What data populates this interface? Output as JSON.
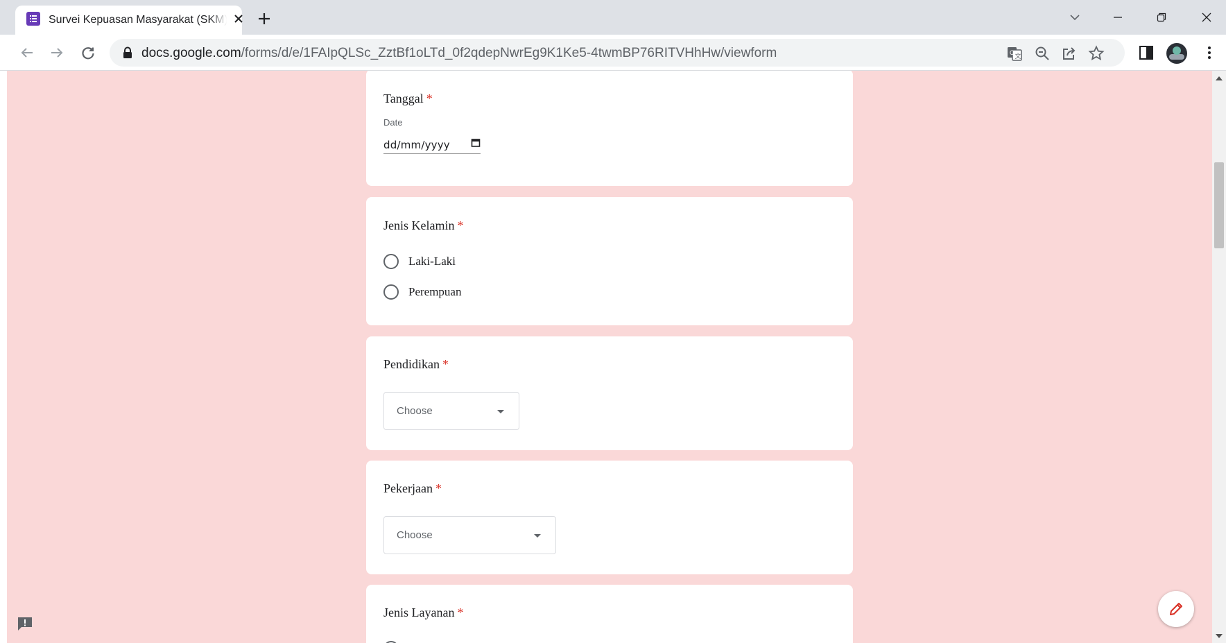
{
  "browser": {
    "tab": {
      "title": "Survei Kepuasan Masyarakat (SKM)",
      "favicon": "google-forms-icon"
    },
    "new_tab_icon": "plus-icon",
    "window_controls": [
      "tab-search-icon",
      "minimize-icon",
      "restore-icon",
      "close-icon"
    ],
    "url": {
      "host": "docs.google.com",
      "path": "/forms/d/e/1FAIpQLSc_ZztBf1oLTd_0f2qdepNwrEg9K1Ke5-4twmBP76RITVHhHw/viewform"
    },
    "toolbar_icons": [
      "translate-icon",
      "zoom-out-icon",
      "share-icon",
      "bookmark-star-icon",
      "side-panel-icon",
      "profile-avatar",
      "more-menu-icon"
    ]
  },
  "theme": {
    "page_background": "#fad8d8",
    "card_background": "#ffffff",
    "required_color": "#d93025",
    "favicon_color": "#673ab7"
  },
  "form": {
    "questions": [
      {
        "title": "Tanggal",
        "required_mark": "*",
        "type": "date",
        "caption": "Date",
        "placeholder": "dd/mm/yyyy"
      },
      {
        "title": "Jenis Kelamin",
        "required_mark": "*",
        "type": "radio",
        "options": [
          "Laki-Laki",
          "Perempuan"
        ]
      },
      {
        "title": "Pendidikan",
        "required_mark": "*",
        "type": "dropdown",
        "selected": "Choose"
      },
      {
        "title": "Pekerjaan",
        "required_mark": "*",
        "type": "dropdown",
        "selected": "Choose"
      },
      {
        "title": "Jenis Layanan",
        "required_mark": "*",
        "type": "radio"
      }
    ]
  },
  "floating": {
    "feedback_icon": "report-feedback-icon",
    "edit_icon": "pencil-icon"
  }
}
